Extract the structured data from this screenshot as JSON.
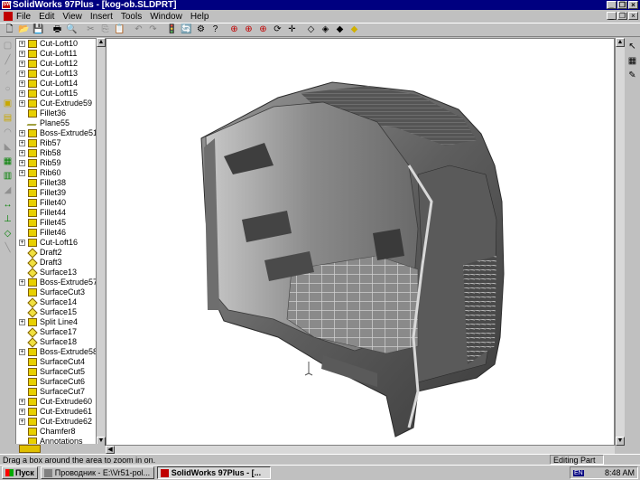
{
  "window": {
    "title": "SolidWorks 97Plus - [kog-ob.SLDPRT]",
    "app_icon_text": "SW",
    "minimize_glyph": "_",
    "restore_glyph": "❐",
    "close_glyph": "×"
  },
  "menu": [
    "File",
    "Edit",
    "View",
    "Insert",
    "Tools",
    "Window",
    "Help"
  ],
  "toolbar": {
    "icons": [
      "new-icon",
      "open-icon",
      "save-icon",
      "print-icon",
      "print-preview-icon",
      "cut-icon",
      "copy-icon",
      "paste-icon",
      "undo-icon",
      "redo-icon",
      "rebuild-icon",
      "redraw-icon",
      "options-icon",
      "whats-this-icon",
      "zoom-fit-icon",
      "zoom-area-icon",
      "zoom-in-out-icon",
      "rotate-icon",
      "pan-icon",
      "wireframe-icon",
      "hidden-lines-icon",
      "hidden-removed-icon",
      "shaded-icon"
    ],
    "glyphs": [
      "🗋",
      "📂",
      "💾",
      "🖶",
      "🔍",
      "✂",
      "⎘",
      "📋",
      "↶",
      "↷",
      "🚦",
      "🔄",
      "⚙",
      "?",
      "⊕",
      "⊕",
      "⊕",
      "⟳",
      "✛",
      "◇",
      "◈",
      "◆",
      "◆"
    ]
  },
  "feature_tree": {
    "items": [
      {
        "label": "Cut-Loft10",
        "icon": "cut-loft-icon",
        "expand": "+"
      },
      {
        "label": "Cut-Loft11",
        "icon": "cut-loft-icon",
        "expand": "+"
      },
      {
        "label": "Cut-Loft12",
        "icon": "cut-loft-icon",
        "expand": "+"
      },
      {
        "label": "Cut-Loft13",
        "icon": "cut-loft-icon",
        "expand": "+"
      },
      {
        "label": "Cut-Loft14",
        "icon": "cut-loft-icon",
        "expand": "+"
      },
      {
        "label": "Cut-Loft15",
        "icon": "cut-loft-icon",
        "expand": "+"
      },
      {
        "label": "Cut-Extrude59",
        "icon": "cut-extrude-icon",
        "expand": "+"
      },
      {
        "label": "Fillet36",
        "icon": "fillet-icon",
        "expand": ""
      },
      {
        "label": "Plane55",
        "icon": "plane-icon",
        "expand": ""
      },
      {
        "label": "Boss-Extrude51",
        "icon": "boss-extrude-icon",
        "expand": "+"
      },
      {
        "label": "Rib57",
        "icon": "rib-icon",
        "expand": "+"
      },
      {
        "label": "Rib58",
        "icon": "rib-icon",
        "expand": "+"
      },
      {
        "label": "Rib59",
        "icon": "rib-icon",
        "expand": "+"
      },
      {
        "label": "Rib60",
        "icon": "rib-icon",
        "expand": "+"
      },
      {
        "label": "Fillet38",
        "icon": "fillet-icon",
        "expand": ""
      },
      {
        "label": "Fillet39",
        "icon": "fillet-icon",
        "expand": ""
      },
      {
        "label": "Fillet40",
        "icon": "fillet-icon",
        "expand": ""
      },
      {
        "label": "Fillet44",
        "icon": "fillet-icon",
        "expand": ""
      },
      {
        "label": "Fillet45",
        "icon": "fillet-icon",
        "expand": ""
      },
      {
        "label": "Fillet46",
        "icon": "fillet-icon",
        "expand": ""
      },
      {
        "label": "Cut-Loft16",
        "icon": "cut-loft-icon",
        "expand": "+"
      },
      {
        "label": "Draft2",
        "icon": "draft-icon",
        "expand": ""
      },
      {
        "label": "Draft3",
        "icon": "draft-icon",
        "expand": ""
      },
      {
        "label": "Surface13",
        "icon": "surface-icon",
        "expand": ""
      },
      {
        "label": "Boss-Extrude57",
        "icon": "boss-extrude-icon",
        "expand": "+"
      },
      {
        "label": "SurfaceCut3",
        "icon": "surface-cut-icon",
        "expand": ""
      },
      {
        "label": "Surface14",
        "icon": "surface-icon",
        "expand": ""
      },
      {
        "label": "Surface15",
        "icon": "surface-icon",
        "expand": ""
      },
      {
        "label": "Split Line4",
        "icon": "split-line-icon",
        "expand": "+"
      },
      {
        "label": "Surface17",
        "icon": "surface-icon",
        "expand": ""
      },
      {
        "label": "Surface18",
        "icon": "surface-icon",
        "expand": ""
      },
      {
        "label": "Boss-Extrude58",
        "icon": "boss-extrude-icon",
        "expand": "+"
      },
      {
        "label": "SurfaceCut4",
        "icon": "surface-cut-icon",
        "expand": ""
      },
      {
        "label": "SurfaceCut5",
        "icon": "surface-cut-icon",
        "expand": ""
      },
      {
        "label": "SurfaceCut6",
        "icon": "surface-cut-icon",
        "expand": ""
      },
      {
        "label": "SurfaceCut7",
        "icon": "surface-cut-icon",
        "expand": ""
      },
      {
        "label": "Cut-Extrude60",
        "icon": "cut-extrude-icon",
        "expand": "+"
      },
      {
        "label": "Cut-Extrude61",
        "icon": "cut-extrude-icon",
        "expand": "+"
      },
      {
        "label": "Cut-Extrude62",
        "icon": "cut-extrude-icon",
        "expand": "+"
      },
      {
        "label": "Chamfer8",
        "icon": "chamfer-icon",
        "expand": ""
      },
      {
        "label": "Annotations",
        "icon": "annotations-icon",
        "expand": ""
      }
    ]
  },
  "left_tools": [
    "sketch-icon",
    "line-icon",
    "arc-icon",
    "circle-icon",
    "extrude-icon",
    "cut-icon",
    "fillet-icon",
    "chamfer-icon",
    "shell-icon",
    "rib-icon",
    "draft-icon",
    "dimension-icon",
    "relation-icon",
    "plane-icon",
    "axis-icon"
  ],
  "left_glyphs": [
    "▢",
    "╱",
    "◜",
    "○",
    "▣",
    "▤",
    "◠",
    "◣",
    "▦",
    "▥",
    "◢",
    "↔",
    "⊥",
    "◇",
    "╲"
  ],
  "right_tools": {
    "select_glyph": "↖",
    "grid_glyph": "▦",
    "sketch_glyph": "✎"
  },
  "scroll_glyphs": {
    "up": "▲",
    "down": "▼",
    "left": "◀",
    "right": "▶"
  },
  "statusbar": {
    "message": "Drag a box around the area to zoom in on.",
    "mode": "Editing Part"
  },
  "taskbar": {
    "start_label": "Пуск",
    "buttons": [
      {
        "label": "Проводник - E:\\Vr51-pol...",
        "active": false
      },
      {
        "label": "SolidWorks 97Plus - [...",
        "active": true
      }
    ],
    "lang": "EN",
    "time": "8:48 AM"
  }
}
